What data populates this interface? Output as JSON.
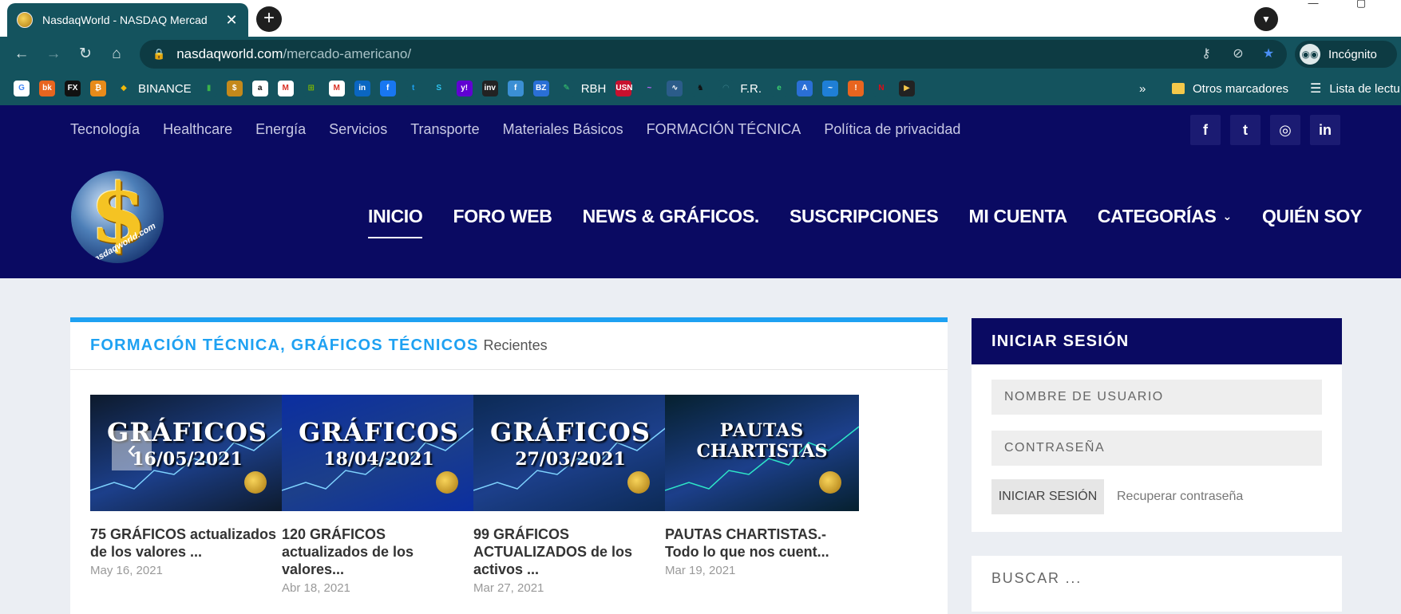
{
  "browser": {
    "tab_title": "NasdaqWorld - NASDAQ Mercad",
    "tab_close": "✕",
    "new_tab": "+",
    "url_host": "nasdaqworld.com",
    "url_path": "/mercado-americano/",
    "incognito_label": "Incógnito",
    "bookmarks": [
      {
        "icon": "G",
        "color": "#ffffff",
        "fg": "#4285f4",
        "label": ""
      },
      {
        "icon": "bk",
        "color": "#e8651f",
        "fg": "#ffffff",
        "label": ""
      },
      {
        "icon": "FX",
        "color": "#111111",
        "fg": "#ffffff",
        "label": ""
      },
      {
        "icon": "₿",
        "color": "#e88b1a",
        "fg": "#ffffff",
        "label": ""
      },
      {
        "icon": "◆",
        "color": "#14535e",
        "fg": "#f0b90b",
        "label": "BINANCE"
      },
      {
        "icon": "▮",
        "color": "#14535e",
        "fg": "#3bb34a",
        "label": ""
      },
      {
        "icon": "$",
        "color": "#c4891b",
        "fg": "#ffffff",
        "label": ""
      },
      {
        "icon": "a",
        "color": "#ffffff",
        "fg": "#111111",
        "label": ""
      },
      {
        "icon": "M",
        "color": "#ffffff",
        "fg": "#d93025",
        "label": ""
      },
      {
        "icon": "⊞",
        "color": "#14535e",
        "fg": "#7fba00",
        "label": ""
      },
      {
        "icon": "M",
        "color": "#ffffff",
        "fg": "#d93025",
        "label": ""
      },
      {
        "icon": "in",
        "color": "#0a66c2",
        "fg": "#ffffff",
        "label": ""
      },
      {
        "icon": "f",
        "color": "#1877f2",
        "fg": "#ffffff",
        "label": ""
      },
      {
        "icon": "t",
        "color": "#14535e",
        "fg": "#1da1f2",
        "label": ""
      },
      {
        "icon": "S",
        "color": "#14535e",
        "fg": "#2ec4f1",
        "label": ""
      },
      {
        "icon": "y!",
        "color": "#6001d2",
        "fg": "#ffffff",
        "label": ""
      },
      {
        "icon": "inv",
        "color": "#222222",
        "fg": "#ffffff",
        "label": ""
      },
      {
        "icon": "f",
        "color": "#3b8fd4",
        "fg": "#ffffff",
        "label": ""
      },
      {
        "icon": "BZ",
        "color": "#2a6fd6",
        "fg": "#ffffff",
        "label": ""
      },
      {
        "icon": "✎",
        "color": "#14535e",
        "fg": "#3bd16f",
        "label": "RBH"
      },
      {
        "icon": "USN",
        "color": "#c8102e",
        "fg": "#ffffff",
        "label": ""
      },
      {
        "icon": "~",
        "color": "#14535e",
        "fg": "#c266ff",
        "label": ""
      },
      {
        "icon": "∿",
        "color": "#2b5c8a",
        "fg": "#ffffff",
        "label": ""
      },
      {
        "icon": "♞",
        "color": "#14535e",
        "fg": "#111111",
        "label": ""
      },
      {
        "icon": "◠",
        "color": "#14535e",
        "fg": "#3a7f8a",
        "label": "F.R."
      },
      {
        "icon": "e",
        "color": "#14535e",
        "fg": "#3bd16f",
        "label": ""
      },
      {
        "icon": "A",
        "color": "#2a6fd6",
        "fg": "#ffffff",
        "label": ""
      },
      {
        "icon": "~",
        "color": "#1f7fd6",
        "fg": "#ffffff",
        "label": ""
      },
      {
        "icon": "!",
        "color": "#e8651f",
        "fg": "#ffffff",
        "label": ""
      },
      {
        "icon": "N",
        "color": "#14535e",
        "fg": "#e50914",
        "label": ""
      },
      {
        "icon": "▶",
        "color": "#222222",
        "fg": "#f4c84a",
        "label": ""
      }
    ],
    "bookmarks_overflow": "»",
    "other_bookmarks": "Otros marcadores",
    "reading_list": "Lista de lectu"
  },
  "site": {
    "secondary_nav": [
      "Tecnología",
      "Healthcare",
      "Energía",
      "Servicios",
      "Transporte",
      "Materiales Básicos",
      "FORMACIÓN TÉCNICA",
      "Política de privacidad"
    ],
    "social": [
      {
        "name": "facebook-icon",
        "glyph": "f"
      },
      {
        "name": "twitter-icon",
        "glyph": "t"
      },
      {
        "name": "instagram-icon",
        "glyph": "◎"
      },
      {
        "name": "linkedin-icon",
        "glyph": "in"
      }
    ],
    "logo_symbol": "$",
    "logo_text": "nasdaqworld.com",
    "main_nav": [
      "INICIO",
      "FORO WEB",
      "NEWS & GRÁFICOS.",
      "SUSCRIPCIONES",
      "MI CUENTA",
      "CATEGORÍAS",
      "QUIÉN SOY"
    ],
    "active_nav": "INICIO"
  },
  "recent": {
    "category": "FORMACIÓN TÉCNICA, GRÁFICOS TÉCNICOS",
    "subtitle": "Recientes",
    "prev": "‹",
    "next": "›",
    "posts": [
      {
        "thumb_line1": "GRÁFICOS",
        "thumb_line2": "16/05/2021",
        "bg": "#0d1a2c",
        "title": "75 GRÁFICOS actualizados de los valores ...",
        "date": "May 16, 2021"
      },
      {
        "thumb_line1": "GRÁFICOS",
        "thumb_line2": "18/04/2021",
        "bg": "#0b2ea0",
        "title": "120 GRÁFICOS actualizados de los valores...",
        "date": "Abr 18, 2021"
      },
      {
        "thumb_line1": "GRÁFICOS",
        "thumb_line2": "27/03/2021",
        "bg": "#0c2a55",
        "title": "99 GRÁFICOS ACTUALIZADOS de los activos ...",
        "date": "Mar 27, 2021"
      },
      {
        "thumb_line1": "PAUTAS",
        "thumb_line2": "CHARTISTAS",
        "bg": "#06202e",
        "title": "PAUTAS CHARTISTAS.- Todo lo que nos cuent...",
        "date": "Mar 19, 2021"
      }
    ]
  },
  "login": {
    "title": "INICIAR SESIÓN",
    "username_placeholder": "NOMBRE DE USUARIO",
    "password_placeholder": "CONTRASEÑA",
    "submit": "INICIAR SESIÓN",
    "recover": "Recuperar contraseña"
  },
  "search": {
    "placeholder": "BUSCAR ..."
  }
}
